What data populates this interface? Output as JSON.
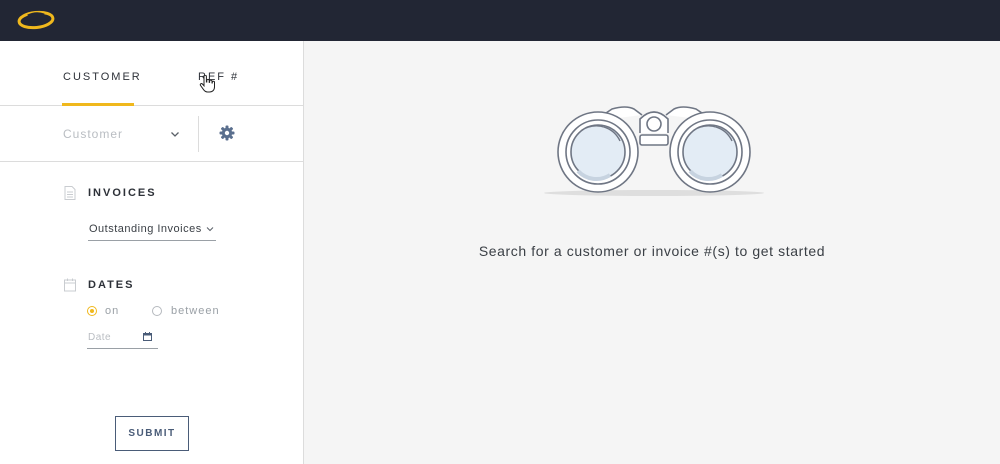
{
  "header": {
    "logo_icon": "swoosh-logo-icon"
  },
  "tabs": [
    {
      "label": "CUSTOMER",
      "active": true
    },
    {
      "label": "REF #",
      "active": false
    }
  ],
  "search": {
    "customer_placeholder": "Customer",
    "chevron_icon": "chevron-down-icon",
    "settings_icon": "gear-icon"
  },
  "invoices": {
    "title": "INVOICES",
    "icon": "document-icon",
    "selected": "Outstanding Invoices"
  },
  "dates": {
    "title": "DATES",
    "icon": "calendar-icon",
    "options": [
      {
        "label": "on",
        "checked": true
      },
      {
        "label": "between",
        "checked": false
      }
    ],
    "date_placeholder": "Date"
  },
  "submit_label": "SUBMIT",
  "empty_state": {
    "icon": "binoculars-icon",
    "message": "Search for a customer or invoice #(s) to get started"
  },
  "colors": {
    "header_bg": "#222634",
    "accent": "#f0b81d",
    "button_border": "#4a5c78",
    "main_bg": "#f5f5f5"
  }
}
